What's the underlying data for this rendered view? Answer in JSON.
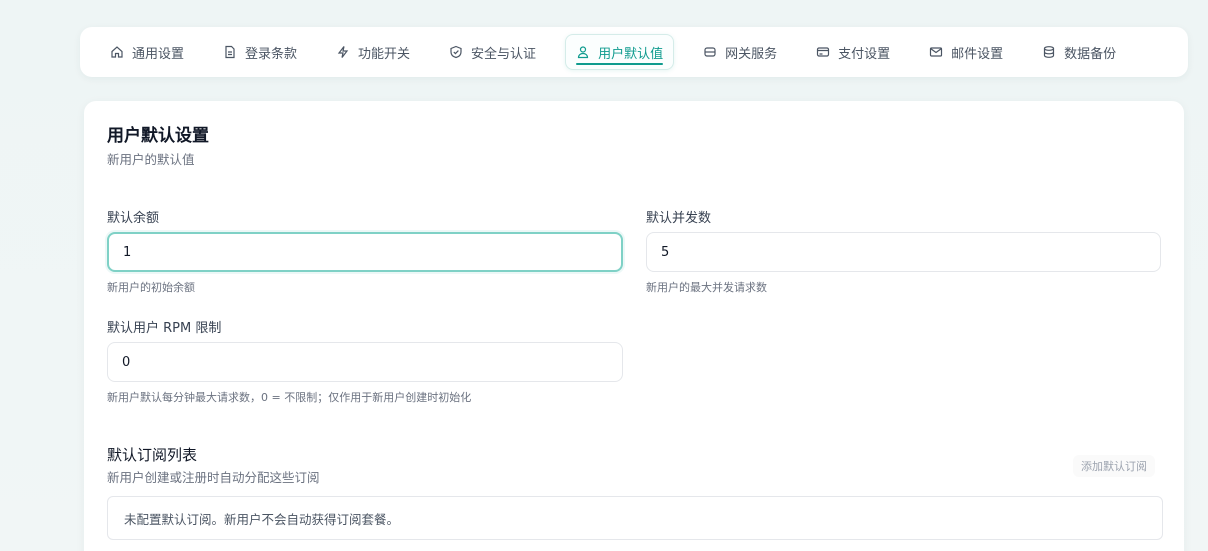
{
  "tabs": [
    {
      "label": "通用设置",
      "icon": "home-icon"
    },
    {
      "label": "登录条款",
      "icon": "document-icon"
    },
    {
      "label": "功能开关",
      "icon": "lightning-icon"
    },
    {
      "label": "安全与认证",
      "icon": "shield-check-icon"
    },
    {
      "label": "用户默认值",
      "icon": "user-icon",
      "active": true
    },
    {
      "label": "网关服务",
      "icon": "server-icon"
    },
    {
      "label": "支付设置",
      "icon": "credit-card-icon"
    },
    {
      "label": "邮件设置",
      "icon": "mail-icon"
    },
    {
      "label": "数据备份",
      "icon": "database-icon"
    }
  ],
  "section": {
    "title": "用户默认设置",
    "subtitle": "新用户的默认值"
  },
  "fields": {
    "balance": {
      "label": "默认余额",
      "value": "1",
      "hint": "新用户的初始余额"
    },
    "concurrency": {
      "label": "默认并发数",
      "value": "5",
      "hint": "新用户的最大并发请求数"
    },
    "rpm": {
      "label": "默认用户 RPM 限制",
      "value": "0",
      "hint": "新用户默认每分钟最大请求数，0 = 不限制；仅作用于新用户创建时初始化"
    }
  },
  "subscriptions": {
    "title": "默认订阅列表",
    "subtitle": "新用户创建或注册时自动分配这些订阅",
    "add_label": "添加默认订阅",
    "empty_text": "未配置默认订阅。新用户不会自动获得订阅套餐。"
  },
  "colors": {
    "accent": "#0f9b8e",
    "focus_border": "#7fd1c6"
  }
}
